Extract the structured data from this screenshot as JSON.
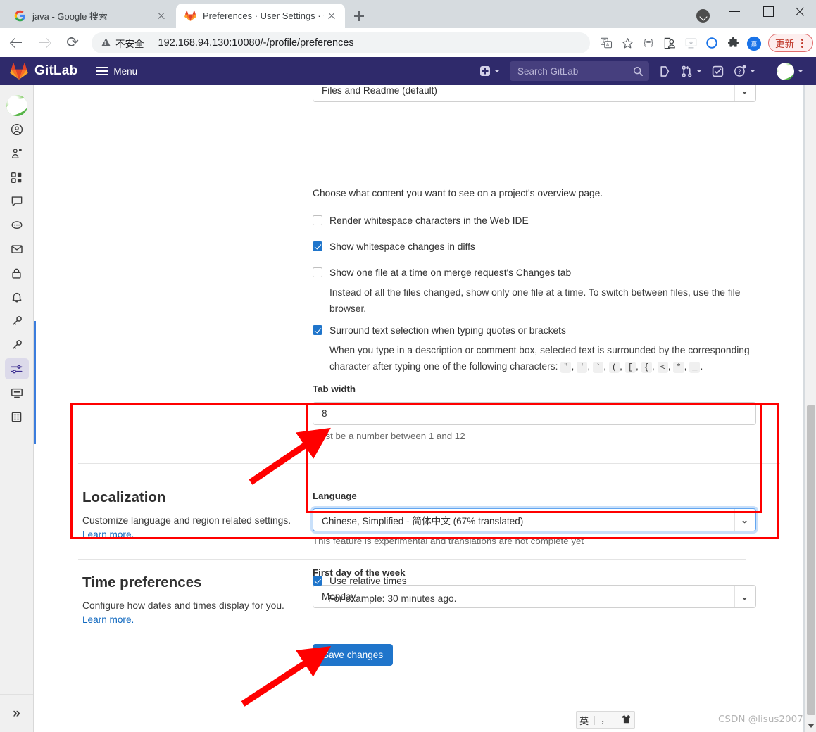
{
  "browser": {
    "tabs": [
      {
        "title": "java - Google 搜索",
        "favicon": "google-icon",
        "active": false
      },
      {
        "title": "Preferences · User Settings · Gi",
        "favicon": "gitlab-icon",
        "active": true
      }
    ],
    "new_tab_label": "+",
    "window_controls": {
      "minimize": "—",
      "maximize": "□",
      "close": "✕"
    },
    "address_bar": {
      "security_label": "不安全",
      "url_host": "192.168.94.130",
      "url_port": ":10080",
      "url_path": "/-/profile/preferences"
    },
    "toolbar_icons": [
      "translate-icon",
      "bookmark-star-icon",
      "extension-equals-icon",
      "user-profile-icon",
      "download-icon",
      "circle-icon",
      "puzzle-extension-icon",
      "avatar-icon"
    ],
    "update_button": "更新",
    "kebab_menu": "kebab-menu-icon"
  },
  "gitlab_nav": {
    "brand": "GitLab",
    "menu_label": "Menu",
    "search_placeholder": "Search GitLab",
    "icons": [
      "plus-dropdown-icon",
      "issues-icon",
      "merge-requests-icon",
      "todos-icon",
      "help-icon",
      "user-avatar"
    ]
  },
  "sidebar": {
    "items": [
      {
        "name": "avatar",
        "icon": "user-avatar"
      },
      {
        "name": "profile",
        "icon": "profile-icon"
      },
      {
        "name": "account",
        "icon": "account-gear-icon"
      },
      {
        "name": "applications",
        "icon": "applications-grid-icon"
      },
      {
        "name": "chat",
        "icon": "chat-bubble-icon"
      },
      {
        "name": "comments",
        "icon": "comment-dots-icon"
      },
      {
        "name": "emails",
        "icon": "envelope-icon"
      },
      {
        "name": "password",
        "icon": "lock-icon"
      },
      {
        "name": "notifications",
        "icon": "bell-icon"
      },
      {
        "name": "ssh-keys",
        "icon": "key-icon"
      },
      {
        "name": "gpg-keys",
        "icon": "key-icon"
      },
      {
        "name": "preferences",
        "icon": "sliders-icon",
        "active": true
      },
      {
        "name": "active-sessions",
        "icon": "monitor-icon"
      },
      {
        "name": "authentication-log",
        "icon": "table-log-icon"
      }
    ],
    "expand_label": "»"
  },
  "main": {
    "overview_select": {
      "value": "Files and Readme (default)"
    },
    "overview_help": "Choose what content you want to see on a project's overview page.",
    "checkboxes": [
      {
        "label": "Render whitespace characters in the Web IDE",
        "checked": false,
        "help": ""
      },
      {
        "label": "Show whitespace changes in diffs",
        "checked": true,
        "help": ""
      },
      {
        "label": "Show one file at a time on merge request's Changes tab",
        "checked": false,
        "help": "Instead of all the files changed, show only one file at a time. To switch between files, use the file browser."
      },
      {
        "label": "Surround text selection when typing quotes or brackets",
        "checked": true,
        "help_prefix": "When you type in a description or comment box, selected text is surrounded by the corresponding character after typing one of the following characters:",
        "help_chars": [
          "\"",
          "'",
          "`",
          "(",
          "[",
          "{",
          "<",
          "*",
          "_"
        ],
        "help_suffix": "."
      }
    ],
    "tab_width": {
      "label": "Tab width",
      "value": "8",
      "help": "Must be a number between 1 and 12"
    },
    "localization": {
      "heading": "Localization",
      "description": "Customize language and region related settings.",
      "learn_more": "Learn more.",
      "language_label": "Language",
      "language_value": "Chinese, Simplified - 简体中文 (67% translated)",
      "language_help": "This feature is experimental and translations are not complete yet",
      "first_day_label": "First day of the week",
      "first_day_value": "Monday"
    },
    "time_preferences": {
      "heading": "Time preferences",
      "description": "Configure how dates and times display for you.",
      "learn_more": "Learn more.",
      "relative_times_label": "Use relative times",
      "relative_times_checked": true,
      "relative_times_help": "For example: 30 minutes ago."
    },
    "save_button": "Save changes"
  },
  "annotations": {
    "highlight_color": "#ff0000",
    "boxes": [
      {
        "name": "localization-section-highlight"
      },
      {
        "name": "language-field-highlight"
      }
    ],
    "arrows": [
      {
        "name": "arrow-to-language-select"
      },
      {
        "name": "arrow-to-save-button"
      }
    ]
  },
  "ime": {
    "mode": "英",
    "punctuation": "，",
    "extra_icon": "shirt-icon"
  },
  "watermark": "CSDN @lisus2007"
}
